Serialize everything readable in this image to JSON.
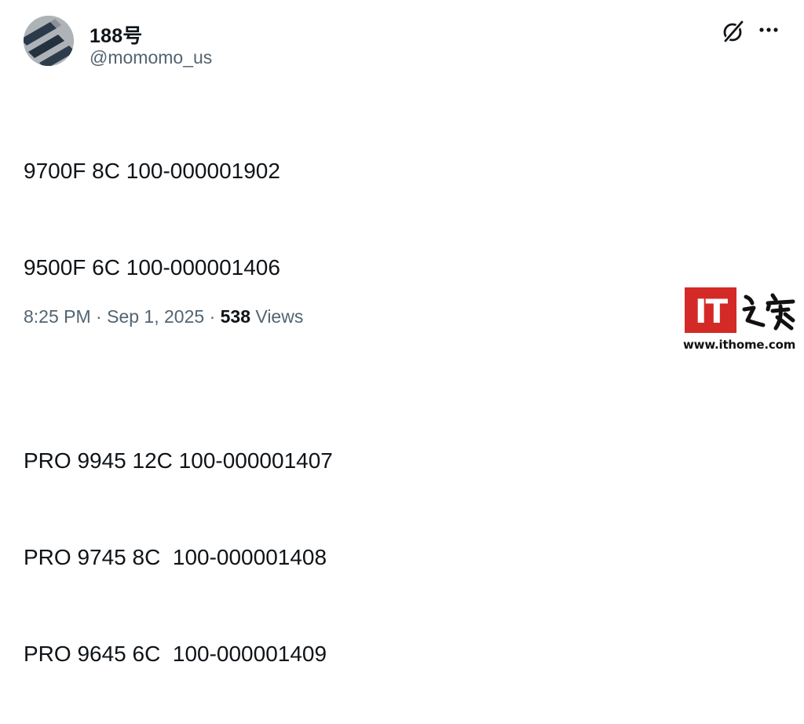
{
  "author": {
    "display_name": "188号",
    "handle": "@momomo_us",
    "avatar_icon": "avatar-image"
  },
  "actions": {
    "grok_icon": "grok-icon",
    "more_icon": "more-icon"
  },
  "tweet": {
    "lines": [
      "9700F 8C 100-000001902",
      "9500F 6C 100-000001406",
      "",
      "PRO 9945 12C 100-000001407",
      "PRO 9745 8C  100-000001408",
      "PRO 9645 6C  100-000001409"
    ],
    "time": "8:25 PM",
    "separator": "·",
    "date": "Sep 1, 2025",
    "views_count": "538",
    "views_label": "Views"
  },
  "watermark": {
    "logo_text": "IT",
    "brand_chars": "之家",
    "url": "www.ithome.com",
    "brand_color": "#d42a27"
  }
}
